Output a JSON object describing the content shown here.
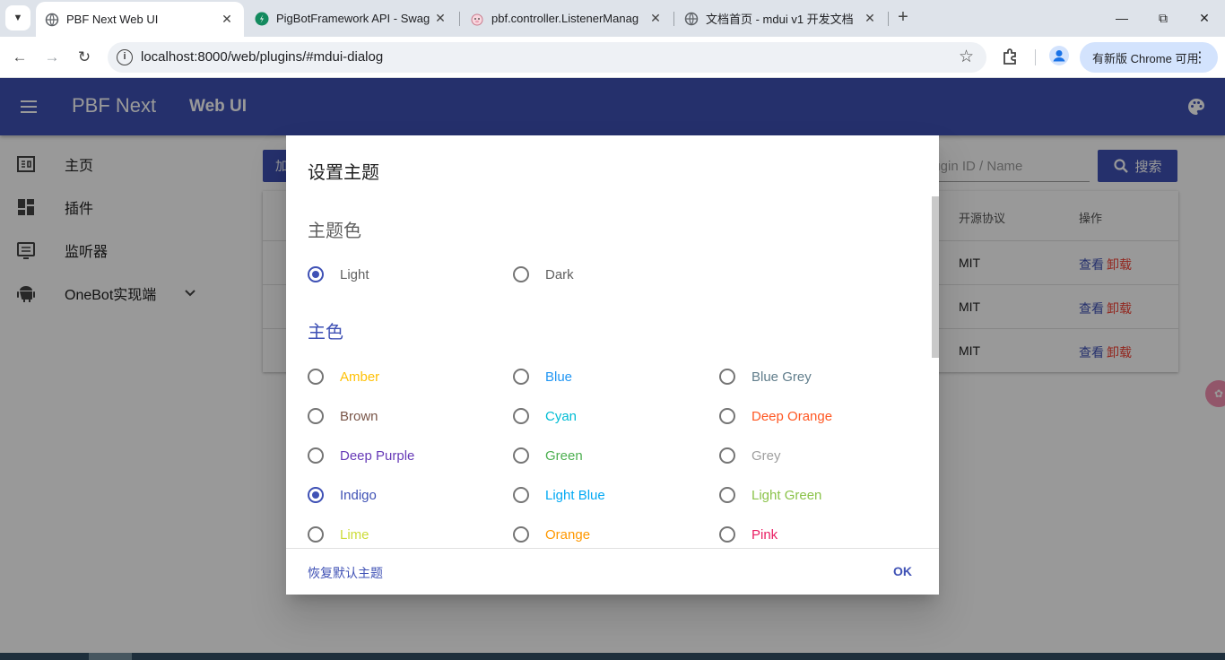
{
  "browser": {
    "tabs": [
      {
        "title": "PBF Next Web UI",
        "icon": "globe-icon"
      },
      {
        "title": "PigBotFramework API - Swag",
        "icon": "swagger-icon"
      },
      {
        "title": "pbf.controller.ListenerManag",
        "icon": "pig-icon"
      },
      {
        "title": "文档首页 - mdui v1 开发文档",
        "icon": "globe-icon"
      }
    ],
    "url": "localhost:8000/web/plugins/#mdui-dialog",
    "update_label": "有新版 Chrome 可用"
  },
  "app": {
    "brand": "PBF Next",
    "subtitle": "Web UI",
    "accent": "#3f51b5"
  },
  "sidebar": {
    "items": [
      {
        "label": "主页",
        "icon": "home-icon"
      },
      {
        "label": "插件",
        "icon": "dashboard-icon"
      },
      {
        "label": "监听器",
        "icon": "listener-icon"
      },
      {
        "label": "OneBot实现端",
        "icon": "android-icon"
      }
    ]
  },
  "main": {
    "add_label": "加",
    "search_placeholder": "Plugin ID / Name",
    "search_label": "搜索",
    "table": {
      "headers": [
        "开源协议",
        "操作"
      ],
      "rows": [
        {
          "license": "MIT",
          "view": "查看",
          "uninstall": "卸载"
        },
        {
          "license": "MIT",
          "view": "查看",
          "uninstall": "卸载"
        },
        {
          "license": "MIT",
          "view": "查看",
          "uninstall": "卸载"
        }
      ]
    }
  },
  "dialog": {
    "title": "设置主题",
    "theme_section": "主题色",
    "theme_options": [
      {
        "label": "Light",
        "selected": true
      },
      {
        "label": "Dark",
        "selected": false
      }
    ],
    "primary_section": "主色",
    "primary_options": [
      {
        "label": "Amber",
        "color": "#ffc107",
        "selected": false
      },
      {
        "label": "Blue",
        "color": "#2196f3",
        "selected": false
      },
      {
        "label": "Blue Grey",
        "color": "#607d8b",
        "selected": false
      },
      {
        "label": "Brown",
        "color": "#795548",
        "selected": false
      },
      {
        "label": "Cyan",
        "color": "#00bcd4",
        "selected": false
      },
      {
        "label": "Deep Orange",
        "color": "#ff5722",
        "selected": false
      },
      {
        "label": "Deep Purple",
        "color": "#673ab7",
        "selected": false
      },
      {
        "label": "Green",
        "color": "#4caf50",
        "selected": false
      },
      {
        "label": "Grey",
        "color": "#9e9e9e",
        "selected": false
      },
      {
        "label": "Indigo",
        "color": "#3f51b5",
        "selected": true
      },
      {
        "label": "Light Blue",
        "color": "#03a9f4",
        "selected": false
      },
      {
        "label": "Light Green",
        "color": "#8bc34a",
        "selected": false
      },
      {
        "label": "Lime",
        "color": "#cddc39",
        "selected": false
      },
      {
        "label": "Orange",
        "color": "#ff9800",
        "selected": false
      },
      {
        "label": "Pink",
        "color": "#e91e63",
        "selected": false
      }
    ],
    "reset_label": "恢复默认主题",
    "ok_label": "OK"
  }
}
